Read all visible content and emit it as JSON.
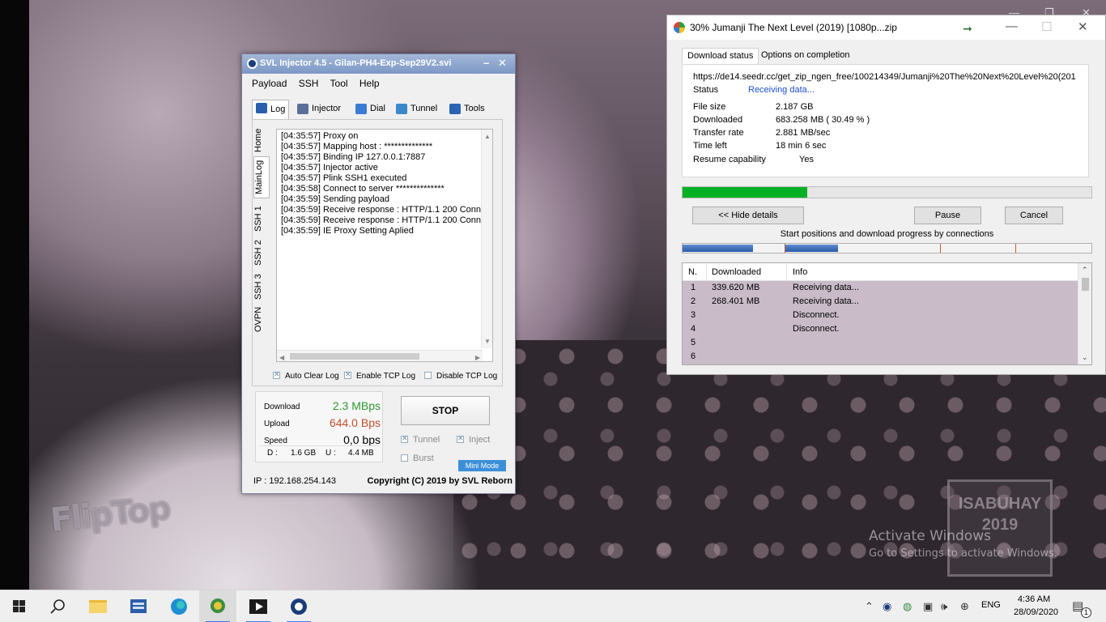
{
  "desktop": {
    "watermark_title": "Activate Windows",
    "watermark_sub": "Go to Settings to activate Windows.",
    "logo_left": "FlipTop",
    "logo_right": "ISABUHAY 2019"
  },
  "svl": {
    "title": "SVL Injector 4.5 - Gilan-PH4-Exp-Sep29V2.svi",
    "title_min": "–",
    "title_close": "✕",
    "menu": [
      "Payload",
      "SSH",
      "Tool",
      "Help"
    ],
    "tabs": [
      {
        "label": "Log",
        "icon_color": "#2a5fb0"
      },
      {
        "label": "Injector",
        "icon_color": "#5b6e9a"
      },
      {
        "label": "Dial",
        "icon_color": "#3a7bd5"
      },
      {
        "label": "Tunnel",
        "icon_color": "#3b89c9"
      },
      {
        "label": "Tools",
        "icon_color": "#2b64b3"
      }
    ],
    "vtabs": [
      "Home",
      "MainLog",
      "SSH 1",
      "SSH 2",
      "SSH 3",
      "OVPN"
    ],
    "log_lines": [
      "[04:35:57] Proxy on",
      "[04:35:57] Mapping host : **************",
      "[04:35:57] Binding IP 127.0.0.1:7887",
      "[04:35:57] Injector active",
      "[04:35:57] Plink SSH1 executed",
      "[04:35:58] Connect to server **************",
      "[04:35:59] Sending payload",
      "[04:35:59] Receive response : HTTP/1.1 200 Conn",
      "[04:35:59] Receive response : HTTP/1.1 200 Conn",
      "[04:35:59] IE Proxy Setting Aplied"
    ],
    "checks": [
      {
        "label": "Auto Clear Log",
        "checked": true
      },
      {
        "label": "Enable TCP Log",
        "checked": true
      },
      {
        "label": "Disable TCP Log",
        "checked": false
      }
    ],
    "stats": {
      "download_label": "Download",
      "download_value": "2.3 MBps",
      "download_color": "#2f9a2f",
      "upload_label": "Upload",
      "upload_value": "644.0 Bps",
      "upload_color": "#c0502a",
      "speed_label": "Speed",
      "speed_value": "0,0 bps",
      "d_label": "D :",
      "d_value": "1.6 GB",
      "u_label": "U :",
      "u_value": "4.4 MB"
    },
    "stop_label": "STOP",
    "options": [
      {
        "label": "Tunnel",
        "checked": true
      },
      {
        "label": "Inject",
        "checked": true
      },
      {
        "label": "Burst",
        "checked": false
      }
    ],
    "mini_mode": "Mini Mode",
    "ip_text": "IP : 192.168.254.143",
    "copyright": "Copyright (C) 2019 by SVL Reborn"
  },
  "idm": {
    "title": "30% Jumanji The Next Level (2019) [1080p...zip",
    "tab_status": "Download status",
    "tab_options": "Options on completion",
    "url": "https://de14.seedr.cc/get_zip_ngen_free/100214349/Jumanji%20The%20Next%20Level%20(201",
    "status_label": "Status",
    "status_value": "Receiving data...",
    "rows": [
      {
        "k": "File size",
        "v": "2.187  GB"
      },
      {
        "k": "Downloaded",
        "v": "683.258  MB  ( 30.49 % )"
      },
      {
        "k": "Transfer rate",
        "v": "2.881  MB/sec"
      },
      {
        "k": "Time left",
        "v": "18 min 6 sec"
      }
    ],
    "resume_label": "Resume capability",
    "resume_value": "Yes",
    "progress": 0.3049,
    "hide_details": "<< Hide details",
    "pause": "Pause",
    "cancel": "Cancel",
    "conn_caption": "Start positions and download progress by connections",
    "columns": [
      "N.",
      "Downloaded",
      "Info"
    ],
    "connections": [
      {
        "n": "1",
        "downloaded": "339.620  MB",
        "info": "Receiving data..."
      },
      {
        "n": "2",
        "downloaded": "268.401  MB",
        "info": "Receiving data..."
      },
      {
        "n": "3",
        "downloaded": "",
        "info": "Disconnect."
      },
      {
        "n": "4",
        "downloaded": "",
        "info": "Disconnect."
      },
      {
        "n": "5",
        "downloaded": "",
        "info": ""
      },
      {
        "n": "6",
        "downloaded": "",
        "info": ""
      }
    ]
  },
  "taskbar": {
    "apps": [
      "start",
      "search",
      "file-explorer",
      "app-blue",
      "edge",
      "idm",
      "media-player",
      "svl-injector"
    ],
    "lang": "ENG",
    "time": "4:36 AM",
    "date": "28/09/2020",
    "notification_count": "1"
  }
}
